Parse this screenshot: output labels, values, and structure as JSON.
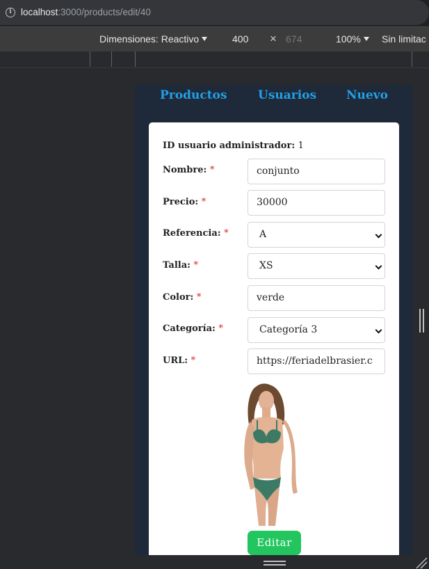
{
  "browser": {
    "url_host": "localhost",
    "url_path": ":3000/products/edit/40"
  },
  "device_toolbar": {
    "dimensions_label": "Dimensiones: Reactivo",
    "width": "400",
    "times": "×",
    "height": "674",
    "zoom": "100%",
    "throttle": "Sin limitac"
  },
  "nav": {
    "products": "Productos",
    "users": "Usuarios",
    "new": "Nuevo"
  },
  "form": {
    "admin_label": "ID usuario administrador:",
    "admin_id": "1",
    "required_mark": "*",
    "fields": {
      "name": {
        "label": "Nombre:",
        "value": "conjunto"
      },
      "price": {
        "label": "Precio:",
        "value": "30000"
      },
      "reference": {
        "label": "Referencia:",
        "value": "A"
      },
      "size": {
        "label": "Talla:",
        "value": "XS"
      },
      "color": {
        "label": "Color:",
        "value": "verde"
      },
      "category": {
        "label": "Categoría:",
        "value": "Categoría 3"
      },
      "url": {
        "label": "URL:",
        "value": "https://feriadelbrasier.c"
      }
    },
    "submit_label": "Editar"
  },
  "colors": {
    "app_background": "#1e2939",
    "nav_link": "#22a0e8",
    "required": "#dc2626",
    "submit_button": "#22c55e",
    "garment": "#3c7a66"
  },
  "icons": {
    "info": "info-icon",
    "dropdown": "chevron-down-icon",
    "close": "close-icon"
  }
}
